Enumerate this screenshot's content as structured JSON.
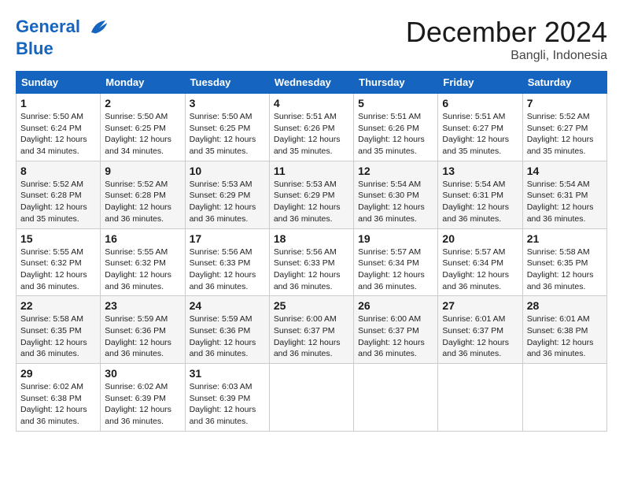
{
  "header": {
    "logo_line1": "General",
    "logo_line2": "Blue",
    "month_title": "December 2024",
    "location": "Bangli, Indonesia"
  },
  "days_of_week": [
    "Sunday",
    "Monday",
    "Tuesday",
    "Wednesday",
    "Thursday",
    "Friday",
    "Saturday"
  ],
  "weeks": [
    [
      {
        "day": "1",
        "sunrise": "5:50 AM",
        "sunset": "6:24 PM",
        "daylight": "12 hours and 34 minutes."
      },
      {
        "day": "2",
        "sunrise": "5:50 AM",
        "sunset": "6:25 PM",
        "daylight": "12 hours and 34 minutes."
      },
      {
        "day": "3",
        "sunrise": "5:50 AM",
        "sunset": "6:25 PM",
        "daylight": "12 hours and 35 minutes."
      },
      {
        "day": "4",
        "sunrise": "5:51 AM",
        "sunset": "6:26 PM",
        "daylight": "12 hours and 35 minutes."
      },
      {
        "day": "5",
        "sunrise": "5:51 AM",
        "sunset": "6:26 PM",
        "daylight": "12 hours and 35 minutes."
      },
      {
        "day": "6",
        "sunrise": "5:51 AM",
        "sunset": "6:27 PM",
        "daylight": "12 hours and 35 minutes."
      },
      {
        "day": "7",
        "sunrise": "5:52 AM",
        "sunset": "6:27 PM",
        "daylight": "12 hours and 35 minutes."
      }
    ],
    [
      {
        "day": "8",
        "sunrise": "5:52 AM",
        "sunset": "6:28 PM",
        "daylight": "12 hours and 35 minutes."
      },
      {
        "day": "9",
        "sunrise": "5:52 AM",
        "sunset": "6:28 PM",
        "daylight": "12 hours and 36 minutes."
      },
      {
        "day": "10",
        "sunrise": "5:53 AM",
        "sunset": "6:29 PM",
        "daylight": "12 hours and 36 minutes."
      },
      {
        "day": "11",
        "sunrise": "5:53 AM",
        "sunset": "6:29 PM",
        "daylight": "12 hours and 36 minutes."
      },
      {
        "day": "12",
        "sunrise": "5:54 AM",
        "sunset": "6:30 PM",
        "daylight": "12 hours and 36 minutes."
      },
      {
        "day": "13",
        "sunrise": "5:54 AM",
        "sunset": "6:31 PM",
        "daylight": "12 hours and 36 minutes."
      },
      {
        "day": "14",
        "sunrise": "5:54 AM",
        "sunset": "6:31 PM",
        "daylight": "12 hours and 36 minutes."
      }
    ],
    [
      {
        "day": "15",
        "sunrise": "5:55 AM",
        "sunset": "6:32 PM",
        "daylight": "12 hours and 36 minutes."
      },
      {
        "day": "16",
        "sunrise": "5:55 AM",
        "sunset": "6:32 PM",
        "daylight": "12 hours and 36 minutes."
      },
      {
        "day": "17",
        "sunrise": "5:56 AM",
        "sunset": "6:33 PM",
        "daylight": "12 hours and 36 minutes."
      },
      {
        "day": "18",
        "sunrise": "5:56 AM",
        "sunset": "6:33 PM",
        "daylight": "12 hours and 36 minutes."
      },
      {
        "day": "19",
        "sunrise": "5:57 AM",
        "sunset": "6:34 PM",
        "daylight": "12 hours and 36 minutes."
      },
      {
        "day": "20",
        "sunrise": "5:57 AM",
        "sunset": "6:34 PM",
        "daylight": "12 hours and 36 minutes."
      },
      {
        "day": "21",
        "sunrise": "5:58 AM",
        "sunset": "6:35 PM",
        "daylight": "12 hours and 36 minutes."
      }
    ],
    [
      {
        "day": "22",
        "sunrise": "5:58 AM",
        "sunset": "6:35 PM",
        "daylight": "12 hours and 36 minutes."
      },
      {
        "day": "23",
        "sunrise": "5:59 AM",
        "sunset": "6:36 PM",
        "daylight": "12 hours and 36 minutes."
      },
      {
        "day": "24",
        "sunrise": "5:59 AM",
        "sunset": "6:36 PM",
        "daylight": "12 hours and 36 minutes."
      },
      {
        "day": "25",
        "sunrise": "6:00 AM",
        "sunset": "6:37 PM",
        "daylight": "12 hours and 36 minutes."
      },
      {
        "day": "26",
        "sunrise": "6:00 AM",
        "sunset": "6:37 PM",
        "daylight": "12 hours and 36 minutes."
      },
      {
        "day": "27",
        "sunrise": "6:01 AM",
        "sunset": "6:37 PM",
        "daylight": "12 hours and 36 minutes."
      },
      {
        "day": "28",
        "sunrise": "6:01 AM",
        "sunset": "6:38 PM",
        "daylight": "12 hours and 36 minutes."
      }
    ],
    [
      {
        "day": "29",
        "sunrise": "6:02 AM",
        "sunset": "6:38 PM",
        "daylight": "12 hours and 36 minutes."
      },
      {
        "day": "30",
        "sunrise": "6:02 AM",
        "sunset": "6:39 PM",
        "daylight": "12 hours and 36 minutes."
      },
      {
        "day": "31",
        "sunrise": "6:03 AM",
        "sunset": "6:39 PM",
        "daylight": "12 hours and 36 minutes."
      },
      null,
      null,
      null,
      null
    ]
  ]
}
